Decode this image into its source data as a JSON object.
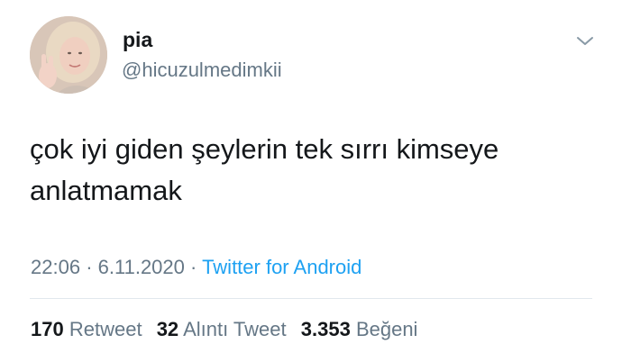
{
  "user": {
    "name": "pia",
    "handle": "@hicuzulmedimkii"
  },
  "tweet": {
    "text": "çok iyi giden şeylerin tek sırrı kimseye anlatmamak",
    "time": "22:06",
    "separator": "·",
    "date": "6.11.2020",
    "source": "Twitter for Android"
  },
  "stats": {
    "retweets_count": "170",
    "retweets_label": "Retweet",
    "quotes_count": "32",
    "quotes_label": "Alıntı Tweet",
    "likes_count": "3.353",
    "likes_label": "Beğeni"
  },
  "icons": {
    "menu": "chevron-down-icon"
  },
  "colors": {
    "link": "#1da1f2",
    "secondary_text": "#657786",
    "primary_text": "#14171a"
  }
}
